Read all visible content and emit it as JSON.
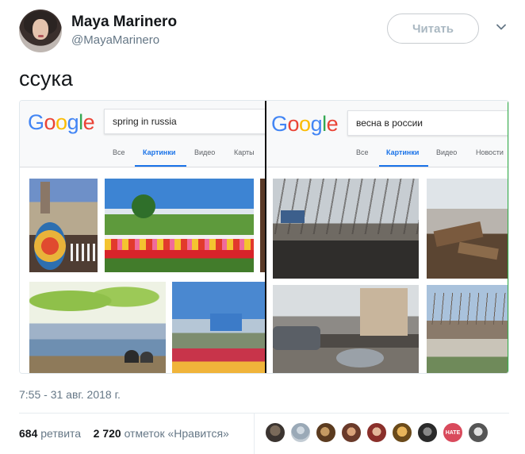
{
  "tweet": {
    "author_name": "Maya Marinero",
    "author_handle": "@MayaMarinero",
    "follow_label": "Читать",
    "text": "ссука",
    "timestamp": "7:55 - 31 авг. 2018 г.",
    "retweets_count": "684",
    "retweets_label": "ретвита",
    "likes_count": "2 720",
    "likes_label": "отметок «Нравится»",
    "liker_avatars": [
      "avatar-1",
      "avatar-2",
      "avatar-3",
      "avatar-4",
      "avatar-5",
      "avatar-6",
      "avatar-7",
      "avatar-8",
      "avatar-9"
    ],
    "liker_hate_text": "HATE"
  },
  "screenshot_left": {
    "logo": "Google",
    "query": "spring in russia",
    "tabs": [
      "Все",
      "Картинки",
      "Видео",
      "Карты"
    ],
    "active_tab": "Картинки"
  },
  "screenshot_right": {
    "logo": "Google",
    "query": "весна в россии",
    "tabs": [
      "Все",
      "Картинки",
      "Видео",
      "Новости"
    ],
    "active_tab": "Картинки"
  },
  "colors": {
    "google_blue": "#4285f4",
    "google_red": "#ea4335",
    "google_yellow": "#fbbc05",
    "google_green": "#34a853",
    "link_blue": "#1a73e8",
    "secondary_text": "#657786"
  },
  "icons": {
    "menu": "chevron-down-icon"
  }
}
